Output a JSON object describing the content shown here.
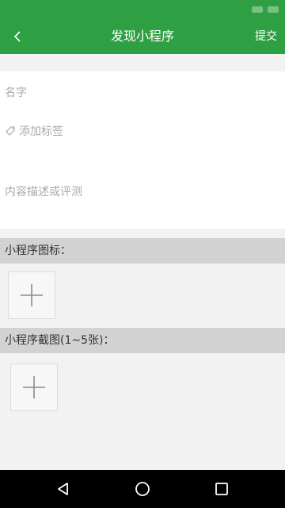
{
  "header": {
    "title": "发现小程序",
    "submit_label": "提交",
    "back_icon": "chevron-left-icon",
    "background_color": "#2ea043"
  },
  "form": {
    "name_placeholder": "名字",
    "tags_placeholder": "添加标签",
    "description_placeholder": "内容描述或评测"
  },
  "sections": {
    "icon_label": "小程序图标：",
    "screenshots_label": "小程序截图(1~5张)："
  },
  "add_icon": "plus-icon",
  "system_nav": {
    "back_icon": "triangle-back-icon",
    "home_icon": "circle-home-icon",
    "recent_icon": "square-recents-icon"
  }
}
